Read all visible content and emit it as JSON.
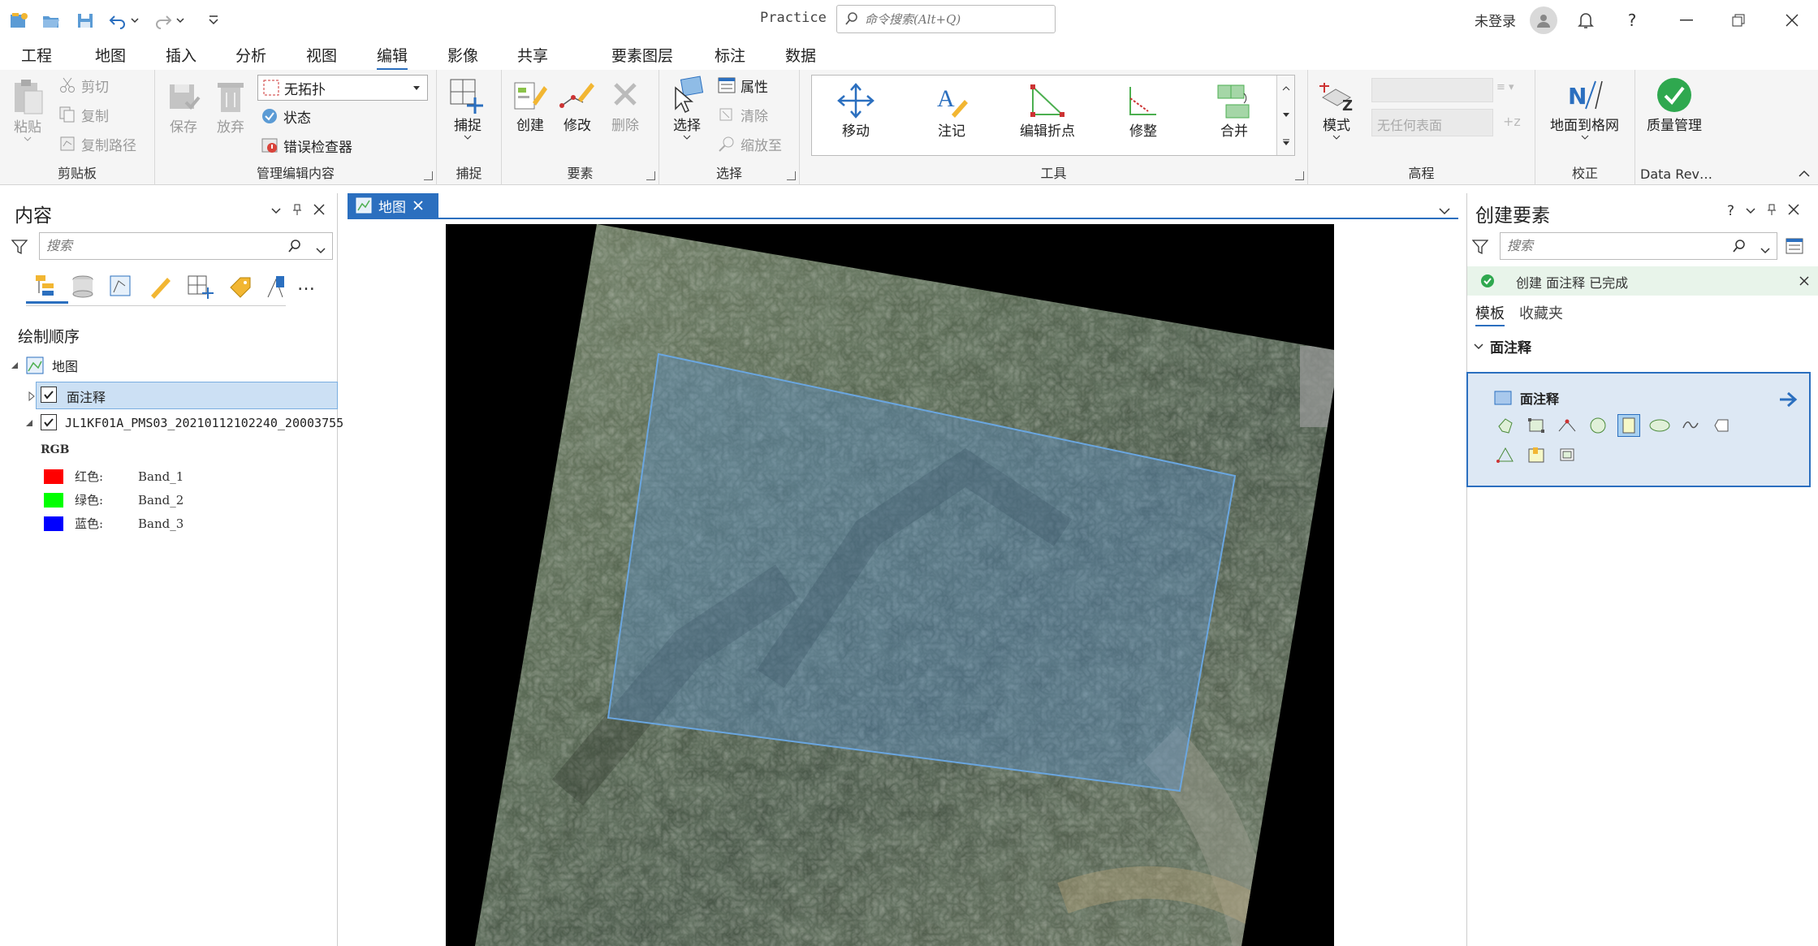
{
  "app": {
    "title": "Practice",
    "login": "未登录"
  },
  "command_search": {
    "placeholder": "命令搜索(Alt+Q)"
  },
  "ribbon_tabs": [
    "工程",
    "地图",
    "插入",
    "分析",
    "视图",
    "编辑",
    "影像",
    "共享",
    "要素图层",
    "标注",
    "数据"
  ],
  "active_tab": "编辑",
  "groups": {
    "clipboard": {
      "label": "剪贴板",
      "paste": "粘贴",
      "cut": "剪切",
      "copy": "复制",
      "copy_path": "复制路径"
    },
    "manage": {
      "label": "管理编辑内容",
      "save": "保存",
      "discard": "放弃",
      "topology": "无拓扑",
      "status": "状态",
      "error_inspector": "错误检查器"
    },
    "snapping": {
      "label": "捕捉",
      "snap": "捕捉"
    },
    "features": {
      "label": "要素",
      "create": "创建",
      "modify": "修改",
      "delete": "删除"
    },
    "selection": {
      "label": "选择",
      "select": "选择",
      "attributes": "属性",
      "clear": "清除",
      "zoom_to": "缩放至"
    },
    "tools": {
      "label": "工具",
      "items": [
        "移动",
        "注记",
        "编辑折点",
        "修整",
        "合并"
      ]
    },
    "elevation": {
      "label": "高程",
      "mode": "模式",
      "surface": "无任何表面"
    },
    "correction": {
      "label": "校正",
      "ground_to_grid": "地面到格网"
    },
    "data_reviewer": {
      "label": "Data Rev…",
      "quality": "质量管理"
    }
  },
  "contents": {
    "title": "内容",
    "search_placeholder": "搜索",
    "drawing_order": "绘制顺序",
    "map_name": "地图",
    "layers": [
      {
        "name": "面注释",
        "checked": true,
        "selected": true
      },
      {
        "name": "JL1KF01A_PMS03_20210112102240_20003755",
        "checked": true,
        "selected": false
      }
    ],
    "rgb_label": "RGB",
    "bands": [
      {
        "channel": "红色:",
        "band": "Band_1",
        "color": "#ff0000"
      },
      {
        "channel": "绿色:",
        "band": "Band_2",
        "color": "#00ff00"
      },
      {
        "channel": "蓝色:",
        "band": "Band_3",
        "color": "#0000ff"
      }
    ]
  },
  "map_tab": {
    "label": "地图"
  },
  "create_features": {
    "title": "创建要素",
    "search_placeholder": "搜索",
    "notification": "创建 面注释 已完成",
    "tabs": [
      "模板",
      "收藏夹"
    ],
    "group": "面注释",
    "template": "面注释"
  },
  "colors": {
    "accent": "#2b6fbf",
    "success": "#2fa84f"
  }
}
